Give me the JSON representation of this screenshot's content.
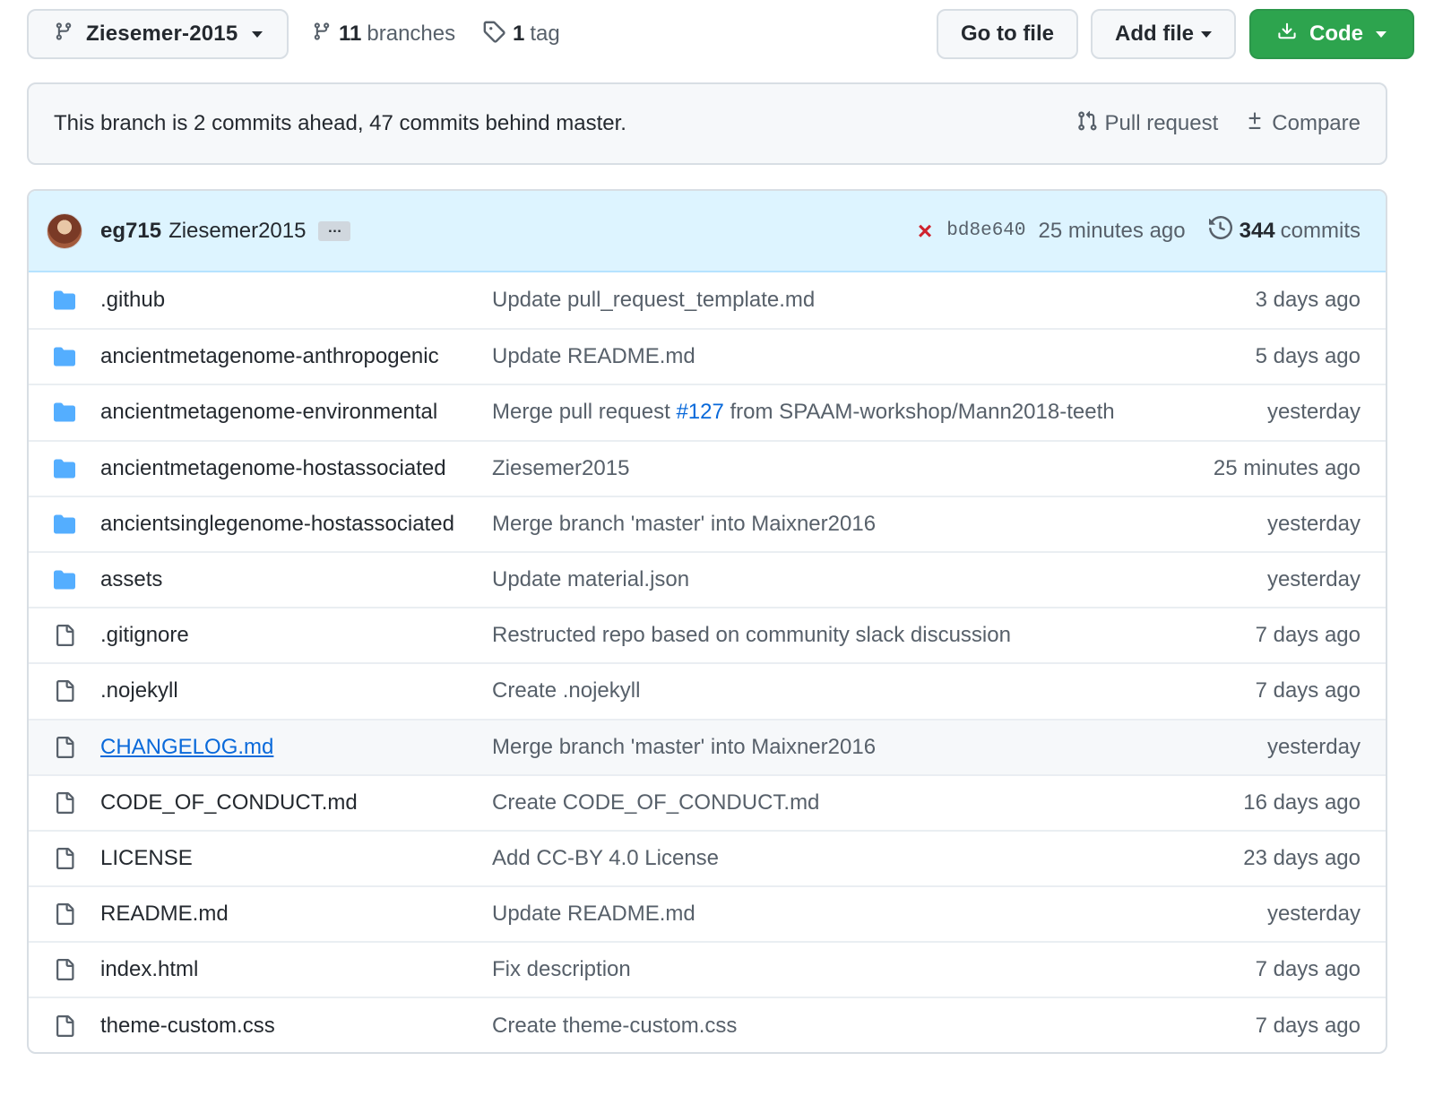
{
  "toolbar": {
    "branch": "Ziesemer-2015",
    "branches_count": "11",
    "branches_label": "branches",
    "tags_count": "1",
    "tags_label": "tag",
    "goto_label": "Go to file",
    "add_label": "Add file",
    "code_label": "Code",
    "accent_green": "#2da44e"
  },
  "banner": {
    "message": "This branch is 2 commits ahead, 47 commits behind master.",
    "pull_request_label": "Pull request",
    "compare_label": "Compare"
  },
  "commit": {
    "author": "eg715",
    "message": "Ziesemer2015",
    "ellipsis": "…",
    "status": "×",
    "sha": "bd8e640",
    "time": "25 minutes ago",
    "commits_count": "344",
    "commits_label": "commits",
    "status_color": "#cf222e"
  },
  "files": [
    {
      "type": "folder",
      "name": ".github",
      "message": "Update pull_request_template.md",
      "age": "3 days ago"
    },
    {
      "type": "folder",
      "name": "ancientmetagenome-anthropogenic",
      "message": "Update README.md",
      "age": "5 days ago"
    },
    {
      "type": "folder",
      "name": "ancientmetagenome-environmental",
      "message_pre": "Merge pull request ",
      "message_link": "#127",
      "message_post": " from SPAAM-workshop/Mann2018-teeth",
      "age": "yesterday"
    },
    {
      "type": "folder",
      "name": "ancientmetagenome-hostassociated",
      "message": "Ziesemer2015",
      "age": "25 minutes ago"
    },
    {
      "type": "folder",
      "name": "ancientsinglegenome-hostassociated",
      "message": "Merge branch 'master' into Maixner2016",
      "age": "yesterday"
    },
    {
      "type": "folder",
      "name": "assets",
      "message": "Update material.json",
      "age": "yesterday"
    },
    {
      "type": "file",
      "name": ".gitignore",
      "message": "Restructed repo based on community slack discussion",
      "age": "7 days ago"
    },
    {
      "type": "file",
      "name": ".nojekyll",
      "message": "Create .nojekyll",
      "age": "7 days ago"
    },
    {
      "type": "file",
      "name": "CHANGELOG.md",
      "message": "Merge branch 'master' into Maixner2016",
      "age": "yesterday"
    },
    {
      "type": "file",
      "name": "CODE_OF_CONDUCT.md",
      "message": "Create CODE_OF_CONDUCT.md",
      "age": "16 days ago"
    },
    {
      "type": "file",
      "name": "LICENSE",
      "message": "Add CC-BY 4.0 License",
      "age": "23 days ago"
    },
    {
      "type": "file",
      "name": "README.md",
      "message": "Update README.md",
      "age": "yesterday"
    },
    {
      "type": "file",
      "name": "index.html",
      "message": "Fix description",
      "age": "7 days ago"
    },
    {
      "type": "file",
      "name": "theme-custom.css",
      "message": "Create theme-custom.css",
      "age": "7 days ago"
    }
  ],
  "icons": {
    "folder": "folder-icon",
    "file": "file-icon",
    "branch": "git-branch-icon",
    "tag": "tag-icon",
    "download": "download-icon",
    "pull_request": "git-pull-request-icon",
    "compare": "diff-icon",
    "history": "history-icon",
    "folder_color": "#54aeff"
  }
}
